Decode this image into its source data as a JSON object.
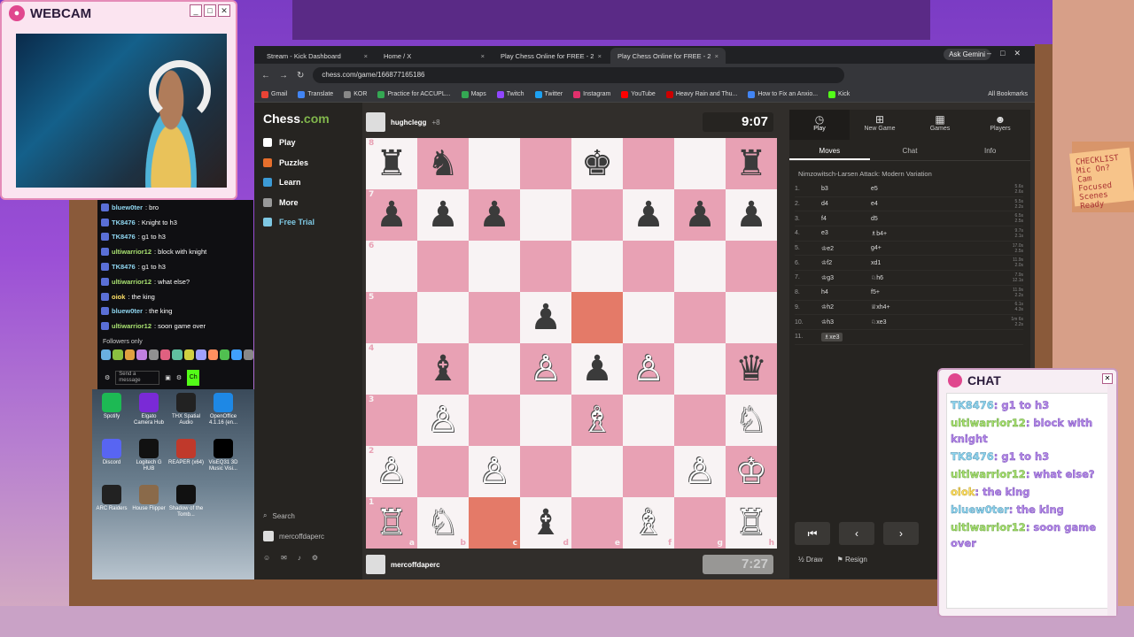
{
  "webcam": {
    "title": "WEBCAM",
    "icon": "camera-icon",
    "buttons": [
      "_",
      "□",
      "✕"
    ]
  },
  "browser": {
    "tabs": [
      {
        "label": "Stream - Kick Dashboard",
        "active": false
      },
      {
        "label": "Home / X",
        "active": false
      },
      {
        "label": "Play Chess Online for FREE - 2",
        "active": false
      },
      {
        "label": "Play Chess Online for FREE - 2",
        "active": true
      }
    ],
    "gemini": "Ask Gemini",
    "url": "chess.com/game/166877165186",
    "bookmarks": [
      "Gmail",
      "Translate",
      "KOR",
      "Practice for ACCUPL...",
      "Maps",
      "Twitch",
      "Twitter",
      "Instagram",
      "YouTube",
      "Heavy Rain and Thu...",
      "How to Fix an Anxio...",
      "Kick"
    ],
    "bookmark_colors": [
      "#ea4335",
      "#4285f4",
      "#888888",
      "#34a853",
      "#34a853",
      "#9146ff",
      "#1da1f2",
      "#e1306c",
      "#ff0000",
      "#cc0000",
      "#4285f4",
      "#53fc18"
    ],
    "all_bookmarks": "All Bookmarks"
  },
  "chess": {
    "logo_a": "Chess",
    "logo_b": ".com",
    "nav": [
      {
        "label": "Play",
        "icon": "pawn-icon",
        "color": "#ffffff"
      },
      {
        "label": "Puzzles",
        "icon": "puzzle-icon",
        "color": "#e76f2c"
      },
      {
        "label": "Learn",
        "icon": "cap-icon",
        "color": "#3c9bd6"
      },
      {
        "label": "More",
        "icon": "chevron-down-icon",
        "color": "#999999"
      },
      {
        "label": "Free Trial",
        "icon": "diamond-icon",
        "color": "#7ec8e3"
      }
    ],
    "search": "Search",
    "username_side": "mercoffdaperc",
    "opponent": {
      "name": "hughclegg",
      "rating": "+8",
      "clock": "9:07"
    },
    "me": {
      "name": "mercoffdaperc",
      "clock": "7:27"
    },
    "board": [
      [
        "br",
        "bn",
        "",
        "",
        "bk",
        "",
        "",
        "br"
      ],
      [
        "bp",
        "bp",
        "bp",
        "",
        "",
        "bp",
        "bp",
        "bp"
      ],
      [
        "",
        "",
        "",
        "",
        "",
        "",
        "",
        ""
      ],
      [
        "",
        "",
        "",
        "bp",
        "",
        "",
        "",
        ""
      ],
      [
        "",
        "bb",
        "",
        "wp",
        "bp",
        "wp",
        "",
        "bq"
      ],
      [
        "",
        "wp",
        "",
        "",
        "wb",
        "",
        "",
        "wn"
      ],
      [
        "wp",
        "",
        "wp",
        "",
        "",
        "",
        "wp",
        "wk"
      ],
      [
        "wr",
        "wn",
        "",
        "bb",
        "",
        "wb",
        "",
        "wr"
      ]
    ],
    "highlight": [
      "3-4",
      "7-2"
    ],
    "ranks": [
      "8",
      "7",
      "6",
      "5",
      "4",
      "3",
      "2",
      "1"
    ],
    "files": [
      "a",
      "b",
      "c",
      "d",
      "e",
      "f",
      "g",
      "h"
    ],
    "panel_tabs": [
      {
        "label": "Play",
        "icon": "clock-icon"
      },
      {
        "label": "New Game",
        "icon": "plus-icon"
      },
      {
        "label": "Games",
        "icon": "grid-icon"
      },
      {
        "label": "Players",
        "icon": "people-icon"
      }
    ],
    "sub_tabs": [
      "Moves",
      "Chat",
      "Info"
    ],
    "opening": "Nimzowitsch-Larsen Attack: Modern Variation",
    "moves": [
      {
        "n": "1.",
        "w": "b3",
        "b": "e5",
        "t1": "5.6s",
        "t2": "2.6s"
      },
      {
        "n": "2.",
        "w": "d4",
        "b": "e4",
        "t1": "5.5s",
        "t2": "2.2s"
      },
      {
        "n": "3.",
        "w": "f4",
        "b": "d5",
        "t1": "6.5s",
        "t2": "2.5s"
      },
      {
        "n": "4.",
        "w": "e3",
        "b": "♗b4+",
        "t1": "9.7s",
        "t2": "2.1s"
      },
      {
        "n": "5.",
        "w": "♔e2",
        "b": "g4+",
        "t1": "17.0s",
        "t2": "2.5s"
      },
      {
        "n": "6.",
        "w": "♔f2",
        "b": "xd1",
        "t1": "11.9s",
        "t2": "2.0s"
      },
      {
        "n": "7.",
        "w": "♔g3",
        "b": "♘h6",
        "t1": "7.9s",
        "t2": "12.1s"
      },
      {
        "n": "8.",
        "w": "h4",
        "b": "f5+",
        "t1": "11.9s",
        "t2": "2.2s"
      },
      {
        "n": "9.",
        "w": "♔h2",
        "b": "♕xh4+",
        "t1": "6.1s",
        "t2": "4.3s"
      },
      {
        "n": "10.",
        "w": "♔h3",
        "b": "♘xe3",
        "t1": "1m 6s",
        "t2": "2.2s"
      },
      {
        "n": "11.",
        "w": "♗xe3",
        "b": "",
        "t1": "",
        "t2": ""
      }
    ],
    "nav_buttons": [
      "⏮",
      "‹",
      "›"
    ],
    "draw": "½ Draw",
    "resign": "⚑ Resign"
  },
  "kick_chat": [
    {
      "user": "bluew0ter",
      "msg": ": bro",
      "color": "#8fd6f0"
    },
    {
      "user": "TK8476",
      "msg": ": Knight to h3",
      "color": "#8fd6f0"
    },
    {
      "user": "TK8476",
      "msg": ": g1 to h3",
      "color": "#8fd6f0"
    },
    {
      "user": "ultiwarrior12",
      "msg": ": block with knight",
      "color": "#a8e070"
    },
    {
      "user": "TK8476",
      "msg": ": g1 to h3",
      "color": "#8fd6f0"
    },
    {
      "user": "ultiwarrior12",
      "msg": ": what else?",
      "color": "#a8e070"
    },
    {
      "user": "oiok",
      "msg": ": the king",
      "color": "#ffe066"
    },
    {
      "user": "bluew0ter",
      "msg": ": the king",
      "color": "#8fd6f0"
    },
    {
      "user": "ultiwarrior12",
      "msg": ": soon game over",
      "color": "#a8e070"
    }
  ],
  "followers_only": "Followers only",
  "send_message": "Send a message",
  "chat_button": "Ch",
  "desktop_icons": [
    {
      "label": "Spotify",
      "color": "#1db954"
    },
    {
      "label": "Elgato Camera Hub",
      "color": "#7a2ad6"
    },
    {
      "label": "THX Spatial Audio",
      "color": "#222222"
    },
    {
      "label": "OpenOffice 4.1.16 (en...",
      "color": "#1e88e5"
    },
    {
      "label": "Discord",
      "color": "#5865f2"
    },
    {
      "label": "Logitech G HUB",
      "color": "#111111"
    },
    {
      "label": "REAPER (x64)",
      "color": "#c0392b"
    },
    {
      "label": "VisEQ31 3D Music Visi...",
      "color": "#000000"
    },
    {
      "label": "ARC Raiders",
      "color": "#222222"
    },
    {
      "label": "House Flipper",
      "color": "#8a6a4a"
    },
    {
      "label": "Shadow of the Tomb...",
      "color": "#111111"
    }
  ],
  "overlay_chat": {
    "title": "CHAT",
    "lines": [
      {
        "user": "TK8476",
        "msg": ": g1 to h3",
        "cls": "u1"
      },
      {
        "user": "ultiwarrior12",
        "msg": ": block with knight",
        "cls": "u2"
      },
      {
        "user": "TK8476",
        "msg": ": g1 to h3",
        "cls": "u1"
      },
      {
        "user": "ultiwarrior12",
        "msg": ": what else?",
        "cls": "u2"
      },
      {
        "user": "oiok",
        "msg": ": the king",
        "cls": "u3"
      },
      {
        "user": "bluew0ter",
        "msg": ": the king",
        "cls": "u1"
      },
      {
        "user": "ultiwarrior12",
        "msg": ": soon game over",
        "cls": "u2"
      }
    ]
  },
  "room_note": "CHECKLIST Mic On? Cam Focused Scenes Ready"
}
